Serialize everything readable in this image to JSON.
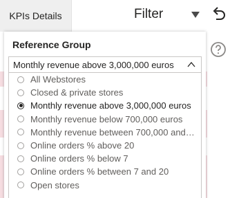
{
  "topbar": {
    "kpi_button_label": "KPIs Details",
    "filter_title": "Filter"
  },
  "icons": {
    "funnel": "funnel-icon",
    "undo": "undo-icon",
    "help": "help-icon",
    "chevron": "chevron-up-icon"
  },
  "filter": {
    "group_label": "Reference Group",
    "selected_value": "Monthly revenue above 3,000,000 euros",
    "options": [
      {
        "label": "All Webstores",
        "selected": false
      },
      {
        "label": "Closed & private stores",
        "selected": false
      },
      {
        "label": "Monthly revenue above 3,000,000 euros",
        "selected": true
      },
      {
        "label": "Monthly revenue below 700,000 euros",
        "selected": false
      },
      {
        "label": "Monthly revenue between 700,000 and 3,...",
        "selected": false
      },
      {
        "label": "Online orders % above 20",
        "selected": false
      },
      {
        "label": "Online orders % below 7",
        "selected": false
      },
      {
        "label": "Online orders % between 7 and 20",
        "selected": false
      },
      {
        "label": "Open stores",
        "selected": false
      }
    ]
  },
  "colors": {
    "background_band": "#f6dde1",
    "button_bg": "#efefef",
    "radio_selected": "#252423"
  }
}
